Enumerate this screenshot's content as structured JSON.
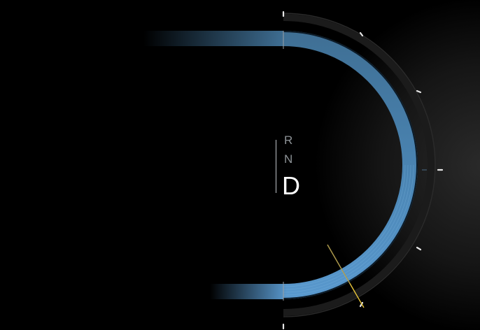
{
  "gear_selector": {
    "options": [
      "R",
      "N",
      "D"
    ],
    "selected": "D"
  },
  "gauge": {
    "arc_color": "#4f8ab8",
    "needle_color": "#e8c53a",
    "tick_color": "#e6e6e6"
  }
}
